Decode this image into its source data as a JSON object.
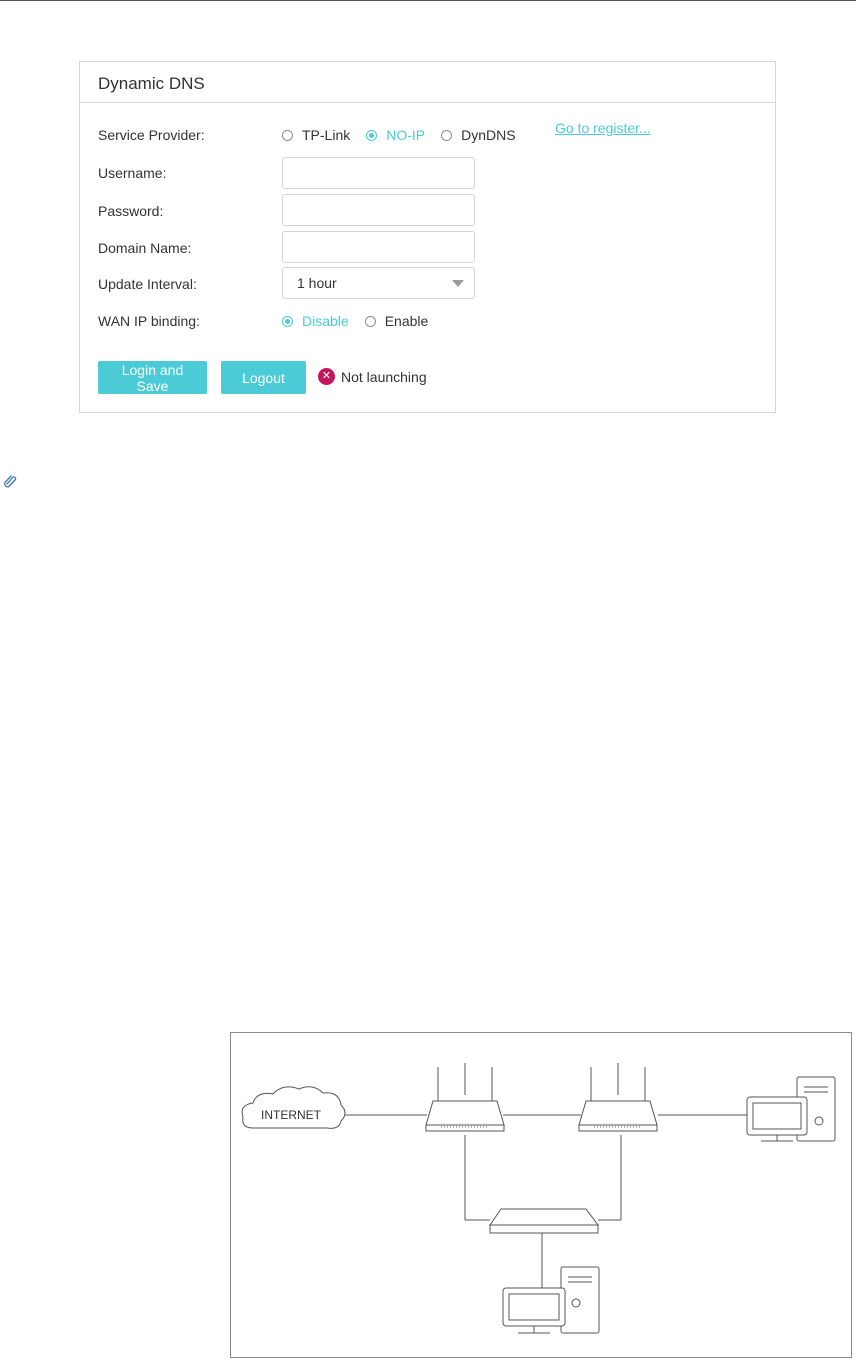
{
  "panel": {
    "title": "Dynamic DNS",
    "service_provider": {
      "label": "Service Provider:",
      "options": [
        "TP-Link",
        "NO-IP",
        "DynDNS"
      ],
      "selected": "NO-IP",
      "register_link": "Go to register..."
    },
    "username": {
      "label": "Username:",
      "value": ""
    },
    "password": {
      "label": "Password:",
      "value": ""
    },
    "domain_name": {
      "label": "Domain Name:",
      "value": ""
    },
    "update_interval": {
      "label": "Update Interval:",
      "value": "1 hour"
    },
    "wan_ip_binding": {
      "label": "WAN IP binding:",
      "options": [
        "Disable",
        "Enable"
      ],
      "selected": "Disable"
    },
    "buttons": {
      "login_save": "Login and Save",
      "logout": "Logout"
    },
    "status": {
      "text": "Not launching",
      "color": "#c2185b"
    }
  },
  "diagram": {
    "internet_label": "INTERNET"
  },
  "colors": {
    "accent": "#4acbd6",
    "border": "#d6d6d6"
  },
  "icons": {
    "note": "paperclip-icon",
    "status": "error-x-icon",
    "dropdown": "chevron-down-icon"
  }
}
